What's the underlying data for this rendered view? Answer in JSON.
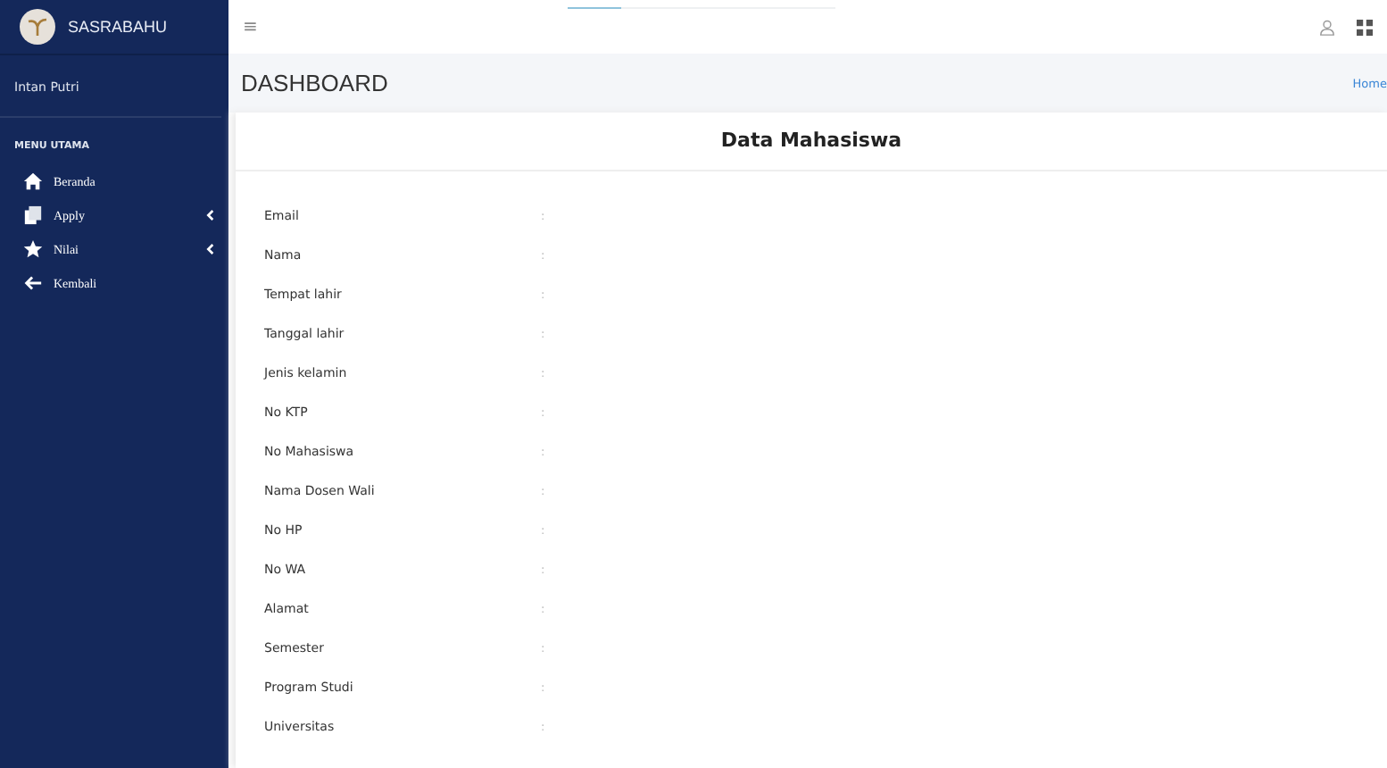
{
  "sidebar": {
    "brand": "SASRABAHU",
    "user": "Intan Putri",
    "section": "MENU UTAMA",
    "items": [
      {
        "label": "Beranda",
        "kind": "home",
        "submenu": false
      },
      {
        "label": "Apply",
        "kind": "files",
        "submenu": true
      },
      {
        "label": "Nilai",
        "kind": "star",
        "submenu": true
      },
      {
        "label": "Kembali",
        "kind": "back",
        "submenu": false
      }
    ]
  },
  "topbar": {
    "menu": "≡",
    "progress": {
      "level": 0.2
    }
  },
  "header": {
    "title": "DASHBOARD",
    "breadcrumb": "Home"
  },
  "card": {
    "title": "Data Mahasiswa",
    "fields": [
      {
        "label": "Email",
        "value": ":"
      },
      {
        "label": "Nama",
        "value": ":"
      },
      {
        "label": "Tempat lahir",
        "value": ":"
      },
      {
        "label": "Tanggal lahir",
        "value": ":"
      },
      {
        "label": "Jenis kelamin",
        "value": ":"
      },
      {
        "label": "No KTP",
        "value": ":"
      },
      {
        "label": "No Mahasiswa",
        "value": ":"
      },
      {
        "label": "Nama Dosen Wali",
        "value": ":"
      },
      {
        "label": "No HP",
        "value": ":"
      },
      {
        "label": "No WA",
        "value": ":"
      },
      {
        "label": "Alamat",
        "value": ":"
      },
      {
        "label": "Semester",
        "value": ":"
      },
      {
        "label": "Program Studi",
        "value": ":"
      },
      {
        "label": "Universitas",
        "value": ":"
      }
    ]
  }
}
